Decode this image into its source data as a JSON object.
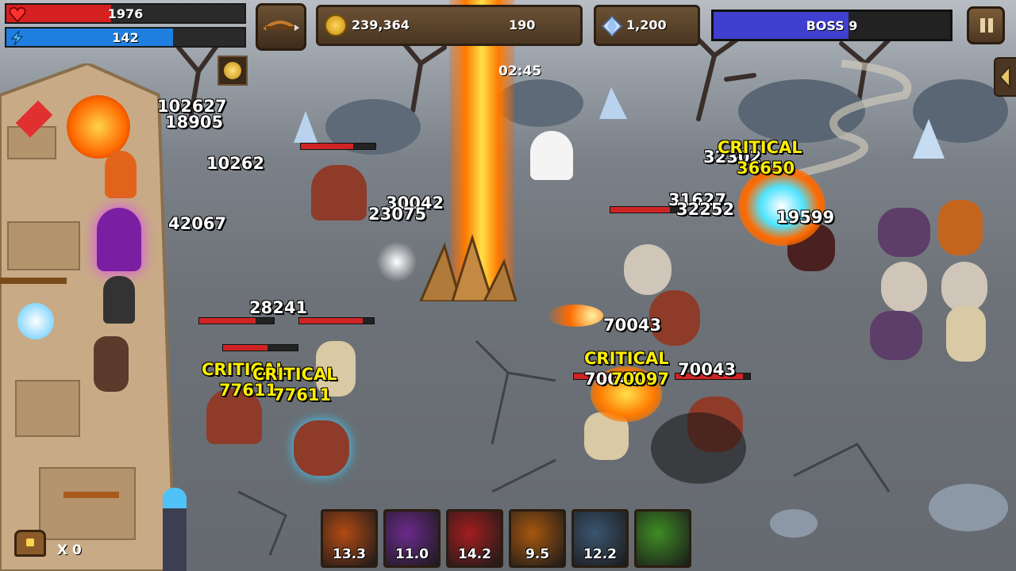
{
  "hud": {
    "health": {
      "value": "1976",
      "fraction": 0.44,
      "color": "#d42020"
    },
    "energy": {
      "value": "142",
      "fraction": 0.7,
      "color": "#1f7fe0"
    },
    "gold": "239,364",
    "secondary_resource": "190",
    "gems": "1,200",
    "boss": {
      "label": "BOSS 9",
      "fraction": 0.57
    },
    "timer": "02:45",
    "treasure_count": "X 0"
  },
  "damage_numbers": [
    {
      "text": "102627"
    },
    {
      "text": "18905"
    },
    {
      "text": "10262"
    },
    {
      "text": "42067"
    },
    {
      "text": "30042"
    },
    {
      "text": "23075"
    },
    {
      "text": "28241"
    },
    {
      "text": "77611"
    },
    {
      "text": "77611"
    },
    {
      "text": "70043"
    },
    {
      "text": "70043"
    },
    {
      "text": "70043"
    },
    {
      "text": "70097"
    },
    {
      "text": "31627"
    },
    {
      "text": "32252"
    },
    {
      "text": "36650"
    },
    {
      "text": "19599"
    },
    {
      "text": "32302"
    }
  ],
  "critical_labels": [
    {
      "text": "CRITICAL"
    },
    {
      "text": "CRITICAL"
    },
    {
      "text": "CRITICAL"
    },
    {
      "text": "CRITICAL"
    }
  ],
  "skills": [
    {
      "name": "fire-slash-skill",
      "cooldown": "13.3",
      "color": "#b24a14"
    },
    {
      "name": "shadow-blade-skill",
      "cooldown": "11.0",
      "color": "#6b2a8c"
    },
    {
      "name": "blood-strike-skill",
      "cooldown": "14.2",
      "color": "#a31e1e"
    },
    {
      "name": "bomb-skill",
      "cooldown": "9.5",
      "color": "#a6570f"
    },
    {
      "name": "tornado-skill",
      "cooldown": "12.2",
      "color": "#3b5570"
    },
    {
      "name": "wind-arrow-skill",
      "cooldown": "",
      "color": "#3f8c24"
    }
  ],
  "icons": [
    "heart-icon",
    "lightning-icon",
    "crossbow-icon",
    "gold-coin-icon",
    "diamond-icon",
    "pause-icon",
    "treasure-chest-icon",
    "back-arrow-icon"
  ]
}
